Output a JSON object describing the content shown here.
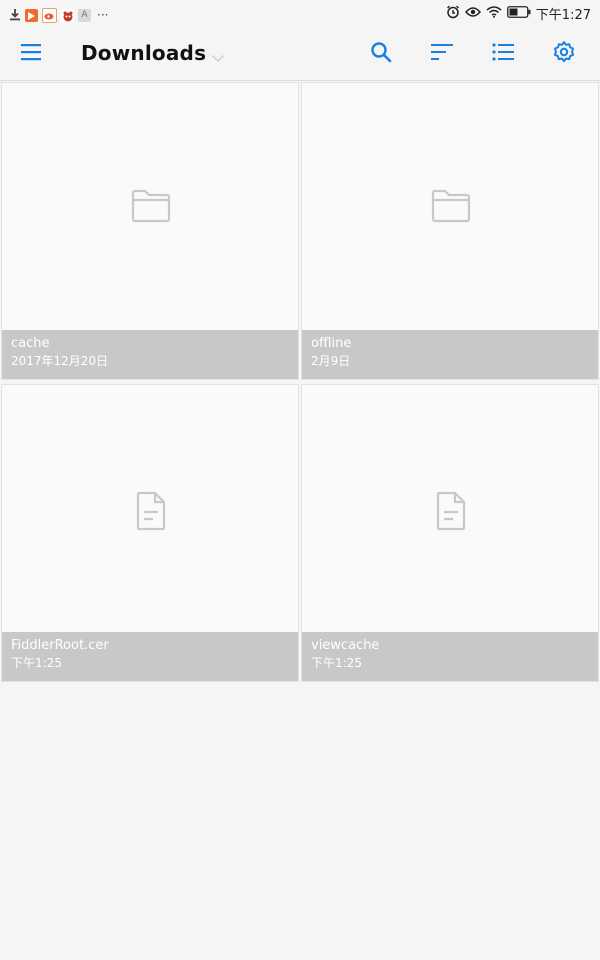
{
  "status_bar": {
    "icons": [
      "download-icon",
      "video-app-icon",
      "weibo-app-icon",
      "baidu-app-icon",
      "a-app-icon",
      "more-icon",
      "alarm-icon",
      "eye-icon",
      "wifi-icon",
      "battery-icon"
    ],
    "more": "···",
    "a_app_glyph": "A",
    "time": "下午1:27"
  },
  "toolbar": {
    "title": "Downloads",
    "icons": [
      "menu-icon",
      "chevron-down-icon",
      "search-icon",
      "sort-icon",
      "list-view-icon",
      "settings-icon"
    ],
    "accent_color": "#1a7fe0"
  },
  "items": [
    {
      "name": "cache",
      "date": "2017年12月20日",
      "type": "folder",
      "icon": "folder-icon"
    },
    {
      "name": "offline",
      "date": "2月9日",
      "type": "folder",
      "icon": "folder-icon"
    },
    {
      "name": "FiddlerRoot.cer",
      "date": "下午1:25",
      "type": "file",
      "icon": "document-icon"
    },
    {
      "name": "viewcache",
      "date": "下午1:25",
      "type": "file",
      "icon": "document-icon"
    }
  ]
}
